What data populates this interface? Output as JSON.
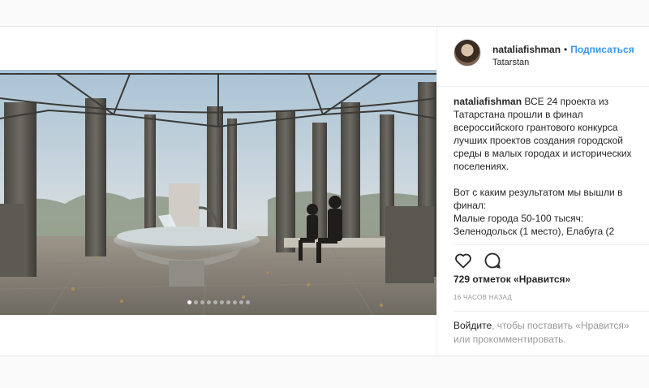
{
  "post": {
    "author": {
      "username": "nataliafishman",
      "separator": "•",
      "follow_label": "Подписаться",
      "location": "Tatarstan",
      "avatar_icon": "profile-avatar"
    },
    "carousel": {
      "total_slides": 10,
      "active_index": 0
    },
    "caption": {
      "username": "nataliafishman",
      "paragraph1": "ВСЕ 24 проекта из Татарстана прошли в финал всероссийского грантового конкурса лучших проектов создания городской среды в малых городах и исторических поселениях.",
      "paragraph2_line1": "Вот с каким результатом мы вышли в финал:",
      "paragraph2_line2": "Малые города 50-100 тысяч:",
      "paragraph2_line3": "Зеленодольск (1 место), Елабуга (2"
    },
    "actions": {
      "like_icon": "heart-icon",
      "comment_icon": "comment-icon"
    },
    "likes_text": "729 отметок «Нравится»",
    "time_text": "16 часов назад",
    "login_prompt": {
      "link_text": "Войдите",
      "rest_line1": ", чтобы поставить «Нравится»",
      "rest_line2": "или прокомментировать."
    },
    "colors": {
      "link_blue": "#3897f0",
      "text": "#262626",
      "muted": "#999999",
      "border": "#efefef"
    }
  }
}
